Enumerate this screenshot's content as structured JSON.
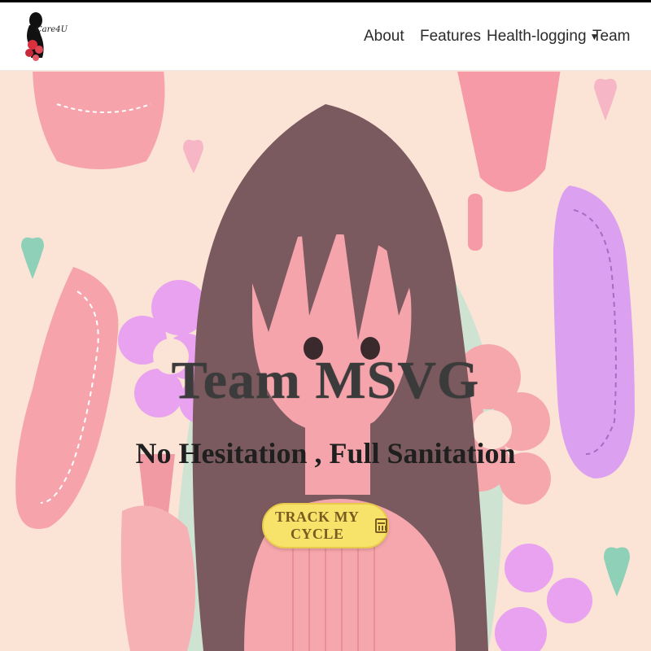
{
  "brand": {
    "name": "Care4U"
  },
  "nav": {
    "items": [
      {
        "label": "About"
      },
      {
        "label": "Features"
      },
      {
        "label": "Health-logging",
        "has_dropdown": true
      },
      {
        "label": "Team"
      }
    ]
  },
  "hero": {
    "title": "Team MSVG",
    "subtitle": "No Hesitation , Full Sanitation",
    "cta_label": "TRACK MY CYCLE"
  },
  "icons": {
    "dropdown": "caret-down-icon",
    "cta": "calendar-icon"
  },
  "colors": {
    "background": "#fbe3d6",
    "hair": "#7a5a5e",
    "pink": "#f7a7b0",
    "lavender": "#e0a3ee",
    "cta_fill": "#f8e36a",
    "mint": "#8ed1b8"
  }
}
